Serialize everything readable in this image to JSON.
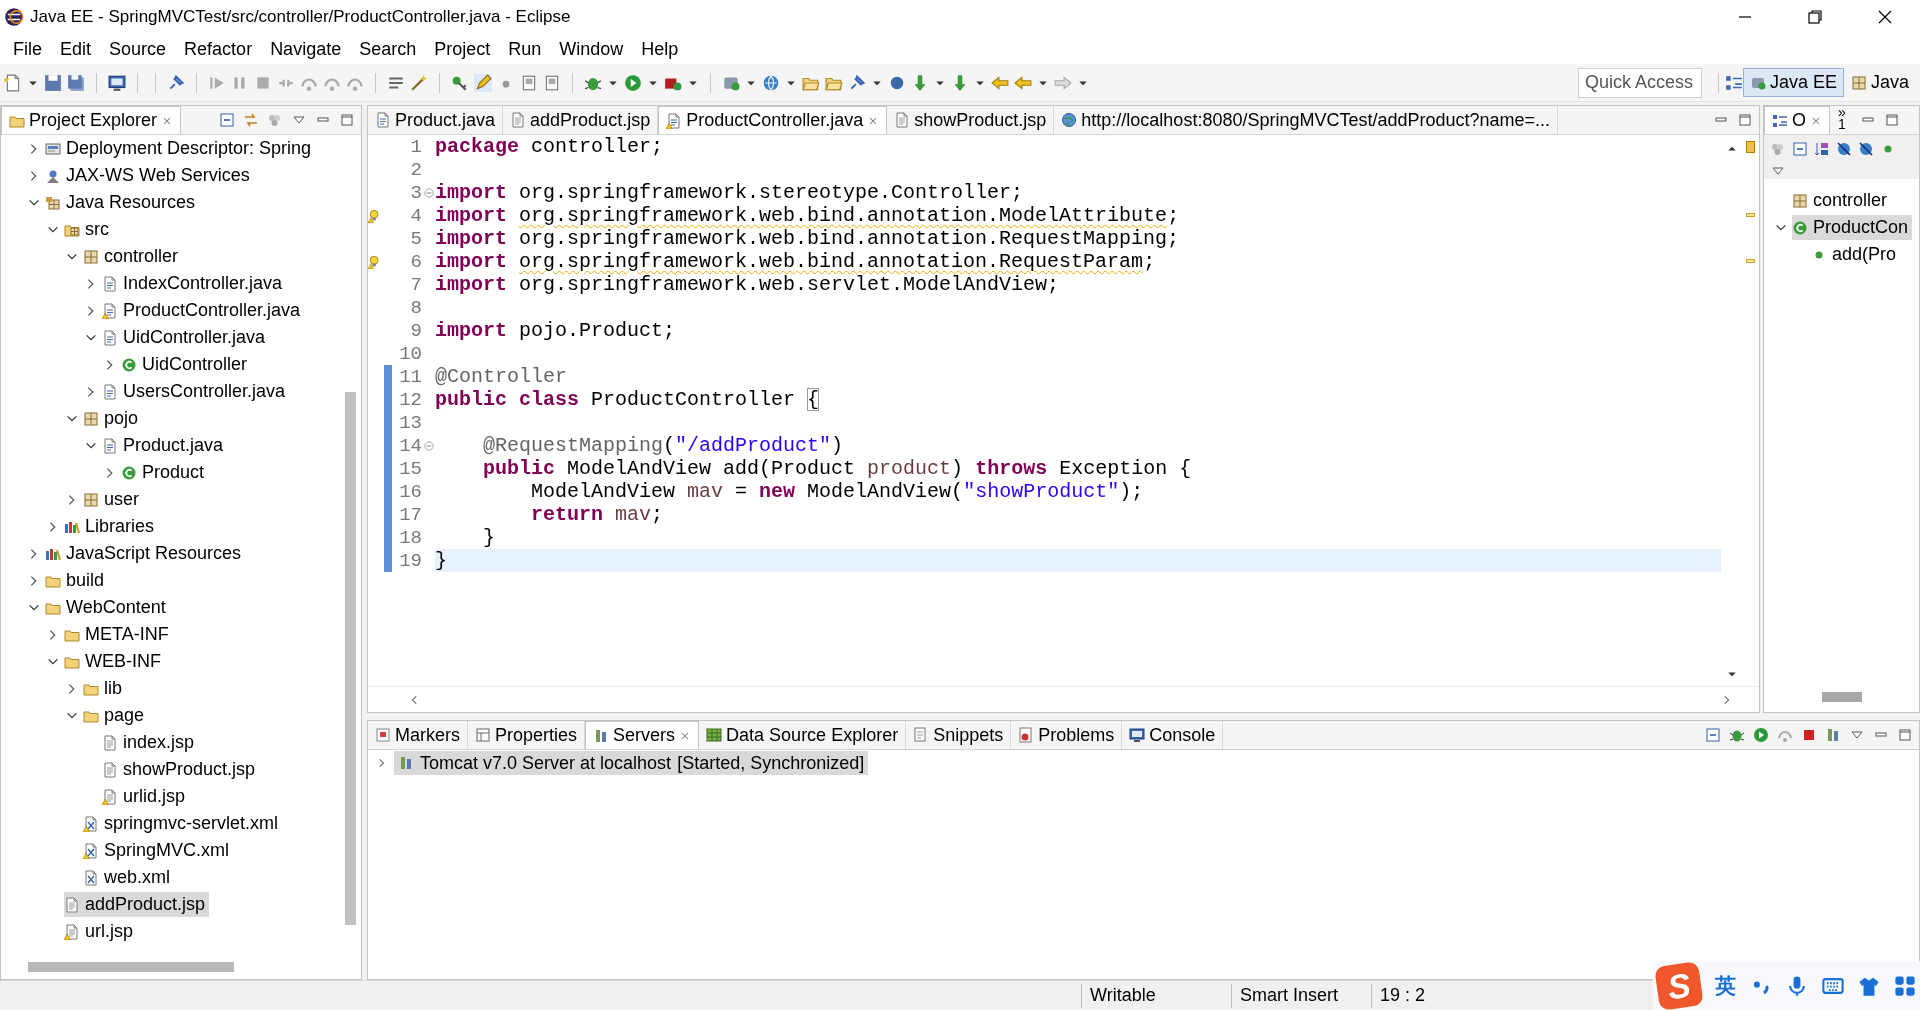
{
  "window": {
    "title": "Java EE - SpringMVCTest/src/controller/ProductController.java - Eclipse"
  },
  "menu": [
    "File",
    "Edit",
    "Source",
    "Refactor",
    "Navigate",
    "Search",
    "Project",
    "Run",
    "Window",
    "Help"
  ],
  "quick_access": {
    "placeholder": "Quick Access"
  },
  "perspectives": [
    {
      "label": "Java EE",
      "selected": true
    },
    {
      "label": "Java",
      "selected": false
    }
  ],
  "project_explorer": {
    "title": "Project Explorer",
    "tree": [
      {
        "label": "Deployment Descriptor: Spring",
        "kind": "descriptor",
        "expanded": false,
        "selected": false
      },
      {
        "label": "JAX-WS Web Services",
        "kind": "webservices",
        "expanded": false,
        "selected": false
      },
      {
        "label": "Java Resources",
        "kind": "javares",
        "expanded": true,
        "selected": false,
        "children": [
          {
            "label": "src",
            "kind": "srcfolder",
            "expanded": true,
            "selected": false,
            "children": [
              {
                "label": "controller",
                "kind": "package",
                "expanded": true,
                "selected": false,
                "children": [
                  {
                    "label": "IndexController.java",
                    "kind": "java",
                    "expanded": false,
                    "selected": false
                  },
                  {
                    "label": "ProductController.java",
                    "kind": "java-warn",
                    "expanded": false,
                    "selected": false
                  },
                  {
                    "label": "UidController.java",
                    "kind": "java",
                    "expanded": true,
                    "selected": false,
                    "children": [
                      {
                        "label": "UidController",
                        "kind": "class",
                        "expanded": false,
                        "selected": false
                      }
                    ]
                  },
                  {
                    "label": "UsersController.java",
                    "kind": "java",
                    "expanded": false,
                    "selected": false
                  }
                ]
              },
              {
                "label": "pojo",
                "kind": "package",
                "expanded": true,
                "selected": false,
                "children": [
                  {
                    "label": "Product.java",
                    "kind": "java",
                    "expanded": true,
                    "selected": false,
                    "children": [
                      {
                        "label": "Product",
                        "kind": "class",
                        "expanded": false,
                        "selected": false
                      }
                    ]
                  }
                ]
              },
              {
                "label": "user",
                "kind": "package",
                "expanded": false,
                "selected": false
              }
            ]
          },
          {
            "label": "Libraries",
            "kind": "libraries",
            "expanded": false,
            "selected": false
          }
        ]
      },
      {
        "label": "JavaScript Resources",
        "kind": "libraries",
        "expanded": false,
        "selected": false
      },
      {
        "label": "build",
        "kind": "folder",
        "expanded": false,
        "selected": false
      },
      {
        "label": "WebContent",
        "kind": "folder",
        "expanded": true,
        "selected": false,
        "children": [
          {
            "label": "META-INF",
            "kind": "folder",
            "expanded": false,
            "selected": false
          },
          {
            "label": "WEB-INF",
            "kind": "folder",
            "expanded": true,
            "selected": false,
            "children": [
              {
                "label": "lib",
                "kind": "folder",
                "expanded": false,
                "selected": false
              },
              {
                "label": "page",
                "kind": "folder",
                "expanded": true,
                "selected": false,
                "children": [
                  {
                    "label": "index.jsp",
                    "kind": "jsp",
                    "selected": false
                  },
                  {
                    "label": "showProduct.jsp",
                    "kind": "jsp",
                    "selected": false
                  },
                  {
                    "label": "urlid.jsp",
                    "kind": "jsp-warn",
                    "selected": false
                  }
                ]
              },
              {
                "label": "springmvc-servlet.xml",
                "kind": "xml-warn",
                "selected": false
              },
              {
                "label": "SpringMVC.xml",
                "kind": "xml-warn",
                "selected": false
              },
              {
                "label": "web.xml",
                "kind": "xml",
                "selected": false
              }
            ]
          },
          {
            "label": "addProduct.jsp",
            "kind": "jsp",
            "selected": true
          },
          {
            "label": "url.jsp",
            "kind": "jsp-warn",
            "selected": false
          }
        ]
      }
    ]
  },
  "editor": {
    "tabs": [
      {
        "label": "Product.java",
        "kind": "java",
        "selected": false
      },
      {
        "label": "addProduct.jsp",
        "kind": "jsp",
        "selected": false
      },
      {
        "label": "ProductController.java",
        "kind": "java-warn",
        "selected": true
      },
      {
        "label": "showProduct.jsp",
        "kind": "jsp",
        "selected": false
      },
      {
        "label": "http://localhost:8080/SpringMVCTest/addProduct?name=...",
        "kind": "globe",
        "selected": false
      }
    ],
    "lines": [
      {
        "number": "1",
        "warning": false,
        "fold": false,
        "changed": false,
        "current": false,
        "tokens": [
          {
            "kind": "keyword",
            "text": "package"
          },
          {
            "kind": "plain",
            "text": " controller;"
          }
        ]
      },
      {
        "number": "2",
        "warning": false,
        "fold": false,
        "changed": false,
        "current": false
      },
      {
        "number": "3",
        "warning": false,
        "fold": true,
        "changed": false,
        "current": false,
        "tokens": [
          {
            "kind": "keyword",
            "text": "import"
          },
          {
            "kind": "plain",
            "text": " org.springframework.stereotype.Controller;"
          }
        ]
      },
      {
        "number": "4",
        "warning": true,
        "fold": false,
        "changed": false,
        "current": false,
        "tokens": [
          {
            "kind": "keyword",
            "text": "import "
          },
          {
            "kind": "warning",
            "text": "org.springframework.web.bind.annotation.ModelAttribute"
          },
          {
            "kind": "plain",
            "text": ";"
          }
        ]
      },
      {
        "number": "5",
        "warning": false,
        "fold": false,
        "changed": false,
        "current": false,
        "tokens": [
          {
            "kind": "keyword",
            "text": "import"
          },
          {
            "kind": "plain",
            "text": " org.springframework.web.bind.annotation.RequestMapping;"
          }
        ]
      },
      {
        "number": "6",
        "warning": true,
        "fold": false,
        "changed": false,
        "current": false,
        "tokens": [
          {
            "kind": "keyword",
            "text": "import "
          },
          {
            "kind": "warning",
            "text": "org.springframework.web.bind.annotation.RequestParam"
          },
          {
            "kind": "plain",
            "text": ";"
          }
        ]
      },
      {
        "number": "7",
        "warning": false,
        "fold": false,
        "changed": false,
        "current": false,
        "tokens": [
          {
            "kind": "keyword",
            "text": "import"
          },
          {
            "kind": "plain",
            "text": " org.springframework.web.servlet.ModelAndView;"
          }
        ]
      },
      {
        "number": "8",
        "warning": false,
        "fold": false,
        "changed": false,
        "current": false
      },
      {
        "number": "9",
        "warning": false,
        "fold": false,
        "changed": false,
        "current": false,
        "tokens": [
          {
            "kind": "keyword",
            "text": "import"
          },
          {
            "kind": "plain",
            "text": " pojo.Product;"
          }
        ]
      },
      {
        "number": "10",
        "warning": false,
        "fold": false,
        "changed": false,
        "current": false
      },
      {
        "number": "11",
        "warning": false,
        "fold": false,
        "changed": true,
        "current": false,
        "tokens": [
          {
            "kind": "annotation",
            "text": "@Controller"
          }
        ]
      },
      {
        "number": "12",
        "warning": false,
        "fold": false,
        "changed": true,
        "current": false,
        "tokens": [
          {
            "kind": "keyword",
            "text": "public class"
          },
          {
            "kind": "plain",
            "text": " ProductController "
          },
          {
            "kind": "bracket",
            "text": "{"
          }
        ]
      },
      {
        "number": "13",
        "warning": false,
        "fold": false,
        "changed": true,
        "current": false
      },
      {
        "number": "14",
        "warning": false,
        "fold": true,
        "changed": true,
        "current": false,
        "tokens": [
          {
            "kind": "annotation",
            "text": "    @RequestMapping"
          },
          {
            "kind": "plain",
            "text": "("
          },
          {
            "kind": "string",
            "text": "\"/addProduct\""
          },
          {
            "kind": "plain",
            "text": ")"
          }
        ]
      },
      {
        "number": "15",
        "warning": false,
        "fold": false,
        "changed": true,
        "current": false,
        "tokens": [
          {
            "kind": "keyword",
            "text": "    public"
          },
          {
            "kind": "plain",
            "text": " ModelAndView add(Product "
          },
          {
            "kind": "variable",
            "text": "product"
          },
          {
            "kind": "plain",
            "text": ") "
          },
          {
            "kind": "keyword",
            "text": "throws"
          },
          {
            "kind": "plain",
            "text": " Exception {"
          }
        ]
      },
      {
        "number": "16",
        "warning": false,
        "fold": false,
        "changed": true,
        "current": false,
        "tokens": [
          {
            "kind": "plain",
            "text": "        ModelAndView "
          },
          {
            "kind": "variable",
            "text": "mav"
          },
          {
            "kind": "plain",
            "text": " = "
          },
          {
            "kind": "keyword",
            "text": "new"
          },
          {
            "kind": "plain",
            "text": " ModelAndView("
          },
          {
            "kind": "string",
            "text": "\"showProduct\""
          },
          {
            "kind": "plain",
            "text": ");"
          }
        ]
      },
      {
        "number": "17",
        "warning": false,
        "fold": false,
        "changed": true,
        "current": false,
        "tokens": [
          {
            "kind": "keyword",
            "text": "        return"
          },
          {
            "kind": "variable",
            "text": " mav"
          },
          {
            "kind": "plain",
            "text": ";"
          }
        ]
      },
      {
        "number": "18",
        "warning": false,
        "fold": false,
        "changed": true,
        "current": false,
        "tokens": [
          {
            "kind": "plain",
            "text": "    }"
          }
        ]
      },
      {
        "number": "19",
        "warning": false,
        "fold": false,
        "changed": true,
        "current": true,
        "tokens": [
          {
            "kind": "plain",
            "text": "}"
          }
        ]
      }
    ]
  },
  "outline": {
    "tab": {
      "label": "O",
      "selected": true
    },
    "overflow": {
      "chevron": "»",
      "count": "1"
    },
    "tree": [
      {
        "label": "controller",
        "kind": "package",
        "selected": false
      },
      {
        "label": "ProductCon",
        "kind": "class",
        "expanded": true,
        "selected": true,
        "children": [
          {
            "label": "add(Pro",
            "kind": "method",
            "selected": false
          }
        ]
      }
    ]
  },
  "bottom_panel": {
    "tabs": [
      {
        "label": "Markers",
        "kind": "markers",
        "selected": false
      },
      {
        "label": "Properties",
        "kind": "properties",
        "selected": false
      },
      {
        "label": "Servers",
        "kind": "servers",
        "selected": true
      },
      {
        "label": "Data Source Explorer",
        "kind": "datasource",
        "selected": false
      },
      {
        "label": "Snippets",
        "kind": "snippets",
        "selected": false
      },
      {
        "label": "Problems",
        "kind": "problems",
        "selected": false
      },
      {
        "label": "Console",
        "kind": "monitor",
        "selected": false
      }
    ],
    "rows": [
      {
        "name": "Tomcat v7.0 Server at localhost",
        "state": "[Started, Synchronized]",
        "expanded": false,
        "selected": true
      }
    ]
  },
  "status_bar": [
    "Writable",
    "Smart Insert",
    "19 : 2"
  ],
  "ime": {
    "logo": "S",
    "mode": "英"
  }
}
